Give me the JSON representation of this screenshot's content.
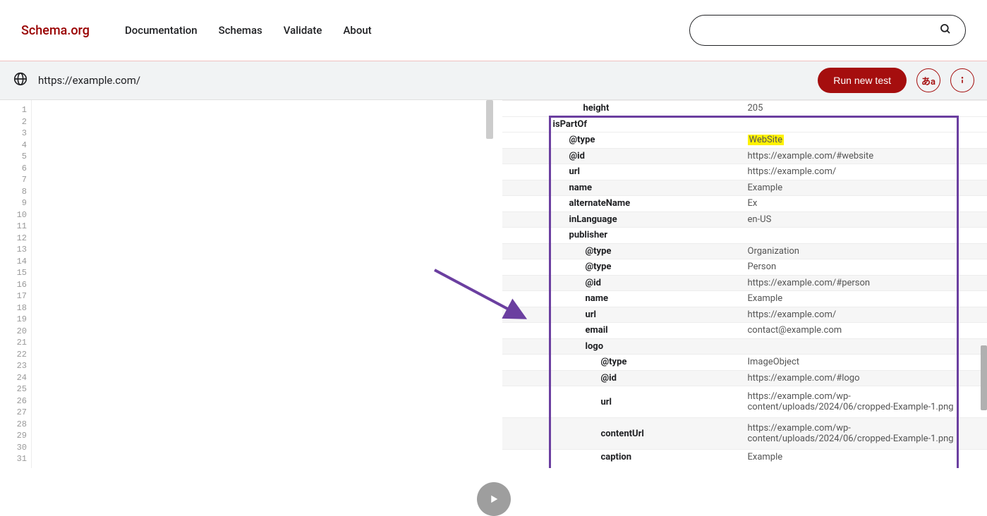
{
  "header": {
    "brand": "Schema.org",
    "nav": [
      "Documentation",
      "Schemas",
      "Validate",
      "About"
    ],
    "search_placeholder": ""
  },
  "toolbar": {
    "url": "https://example.com/",
    "run_label": "Run new test",
    "lang_btn": "あa"
  },
  "editor": {
    "line_start": 1,
    "line_end": 31
  },
  "results": [
    {
      "indent": 115,
      "key": "height",
      "value": "205",
      "alt": false
    },
    {
      "indent": 72,
      "key": "isPartOf",
      "value": "",
      "alt": false,
      "section": true
    },
    {
      "indent": 95,
      "key": "@type",
      "value": "WebSite",
      "alt": false,
      "highlight": true
    },
    {
      "indent": 95,
      "key": "@id",
      "value": "https://example.com/#website",
      "alt": true
    },
    {
      "indent": 95,
      "key": "url",
      "value": "https://example.com/",
      "alt": false
    },
    {
      "indent": 95,
      "key": "name",
      "value": "Example",
      "alt": true
    },
    {
      "indent": 95,
      "key": "alternateName",
      "value": "Ex",
      "alt": false
    },
    {
      "indent": 95,
      "key": "inLanguage",
      "value": "en-US",
      "alt": true
    },
    {
      "indent": 95,
      "key": "publisher",
      "value": "",
      "alt": false,
      "section": true
    },
    {
      "indent": 118,
      "key": "@type",
      "value": "Organization",
      "alt": true
    },
    {
      "indent": 118,
      "key": "@type",
      "value": "Person",
      "alt": false
    },
    {
      "indent": 118,
      "key": "@id",
      "value": "https://example.com/#person",
      "alt": true
    },
    {
      "indent": 118,
      "key": "name",
      "value": "Example",
      "alt": false
    },
    {
      "indent": 118,
      "key": "url",
      "value": "https://example.com/",
      "alt": true
    },
    {
      "indent": 118,
      "key": "email",
      "value": "contact@example.com",
      "alt": false
    },
    {
      "indent": 118,
      "key": "logo",
      "value": "",
      "alt": true,
      "section": true
    },
    {
      "indent": 140,
      "key": "@type",
      "value": "ImageObject",
      "alt": false
    },
    {
      "indent": 140,
      "key": "@id",
      "value": "https://example.com/#logo",
      "alt": true
    },
    {
      "indent": 140,
      "key": "url",
      "value": "https://example.com/wp-content/uploads/2024/06/cropped-Example-1.png",
      "alt": false,
      "tall": true
    },
    {
      "indent": 140,
      "key": "contentUrl",
      "value": "https://example.com/wp-content/uploads/2024/06/cropped-Example-1.png",
      "alt": true,
      "tall": true
    },
    {
      "indent": 140,
      "key": "caption",
      "value": "Example",
      "alt": false
    }
  ]
}
